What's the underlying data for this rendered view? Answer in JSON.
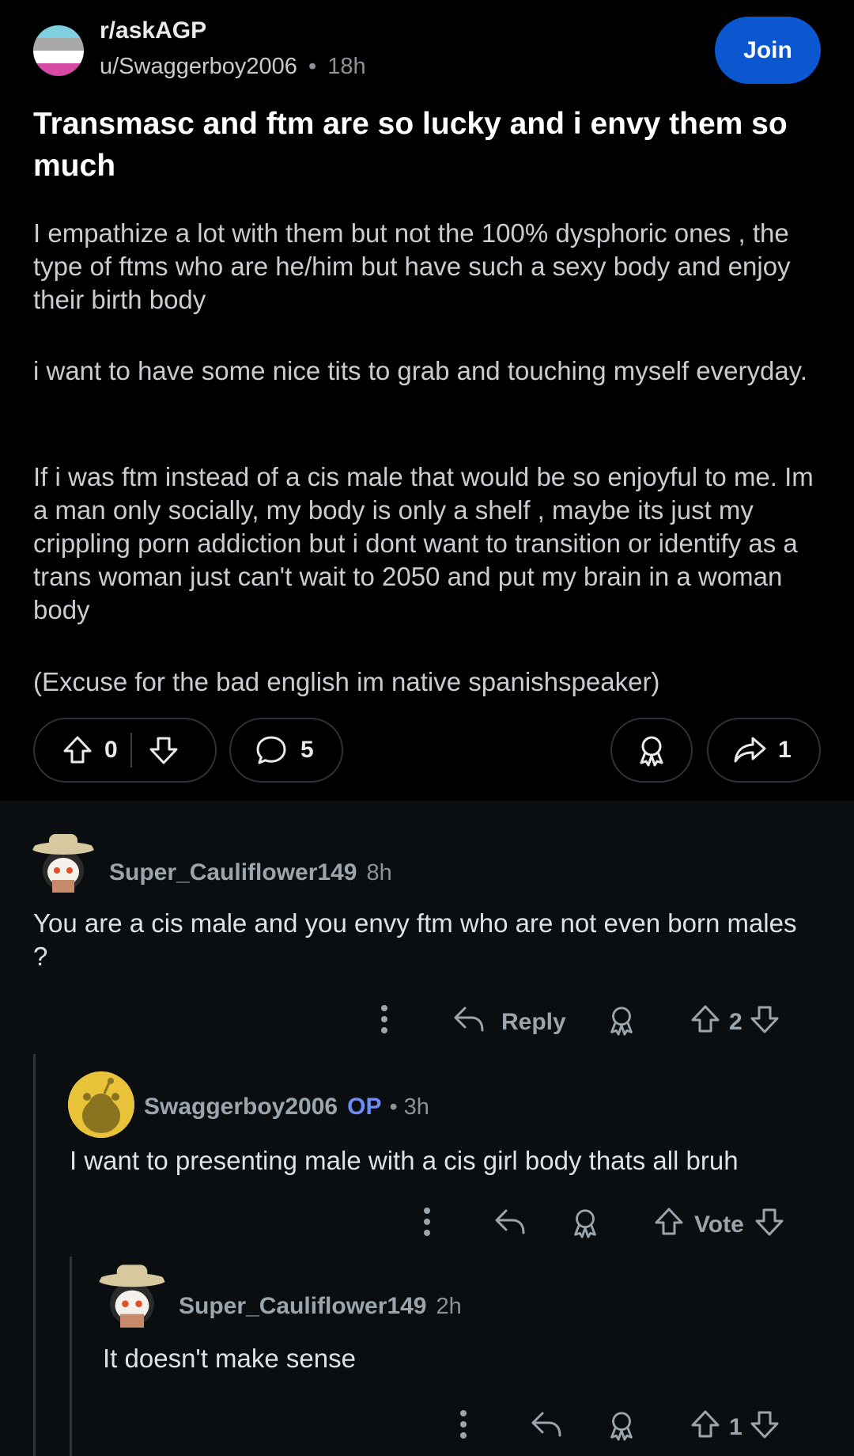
{
  "post": {
    "subreddit": "r/askAGP",
    "author": "u/Swaggerboy2006",
    "separator": "•",
    "age": "18h",
    "join_label": "Join",
    "title": "Transmasc and ftm are so lucky and i envy them so much",
    "paragraphs": [
      "I empathize a lot with them but not the 100% dysphoric ones , the type of ftms who are he/him but have such a sexy body and enjoy their birth body",
      "i want to have some nice tits to grab and touching myself everyday.",
      "If i was ftm instead of a cis male that would be so enjoyful to me. Im a man only socially, my body is only a shelf , maybe its just my crippling porn addiction but i dont want to transition or identify as a trans woman just can't wait to 2050 and put my brain in a woman body",
      "(Excuse for the bad english im native spanishspeaker)"
    ],
    "vote_count": "0",
    "comment_count": "5",
    "share_count": "1"
  },
  "comments": [
    {
      "author": "Super_Cauliflower149",
      "age": "8h",
      "text": "You are a cis male and you envy ftm who are not even born males ?",
      "reply_label": "Reply",
      "votes": "2"
    },
    {
      "author": "Swaggerboy2006",
      "op_badge": "OP",
      "separator": "•",
      "age": "3h",
      "text": "I want to presenting male with a cis girl body thats all bruh",
      "votes": "Vote"
    },
    {
      "author": "Super_Cauliflower149",
      "age": "2h",
      "text": "It doesn't make sense",
      "votes": "1"
    }
  ],
  "colors": {
    "join_button": "#0a57d0",
    "op_badge": "#6e8cf3",
    "post_background": "#000000",
    "comments_background": "#0b0e11"
  },
  "icons": [
    "upvote-icon",
    "downvote-icon",
    "comment-icon",
    "award-icon",
    "share-icon",
    "more-icon",
    "reply-icon"
  ]
}
